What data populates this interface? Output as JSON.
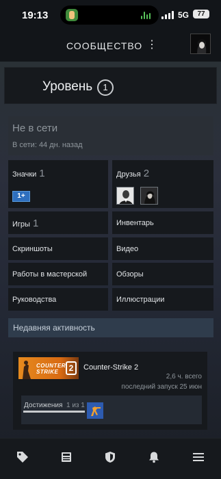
{
  "status_bar": {
    "time": "19:13",
    "network": "5G",
    "battery": "77"
  },
  "header": {
    "title": "СООБЩЕСТВО",
    "menu_icon": "more-vertical-icon"
  },
  "profile": {
    "level_label": "Уровень",
    "level_value": "1",
    "status_title": "Не в сети",
    "status_sub": "В сети: 44 дн. назад"
  },
  "tiles": {
    "badges_label": "Значки",
    "badges_count": "1",
    "badge_icon_text": "1+",
    "friends_label": "Друзья",
    "friends_count": "2",
    "games_label": "Игры",
    "games_count": "1",
    "inventory_label": "Инвентарь",
    "screenshots_label": "Скриншоты",
    "video_label": "Видео",
    "workshop_label": "Работы в мастерской",
    "reviews_label": "Обзоры",
    "guides_label": "Руководства",
    "artwork_label": "Иллюстрации"
  },
  "activity": {
    "header": "Недавняя активность",
    "game": {
      "name": "Counter-Strike 2",
      "capsule_text": "COUNTER STRIKE",
      "capsule_num": "2",
      "hours": "2,6 ч. всего",
      "last_played": "последний запуск 25 июн",
      "achievements_label": "Достижения",
      "achievements_count": "1 из 1",
      "achievements_progress": 1.0
    }
  },
  "bottom_nav": [
    "tag-icon",
    "news-icon",
    "shield-icon",
    "bell-icon",
    "menu-icon"
  ],
  "colors": {
    "background": "#121519",
    "tile": "#16191d",
    "activity_header": "#2f3c4c",
    "badge": "#2e6fbe"
  }
}
